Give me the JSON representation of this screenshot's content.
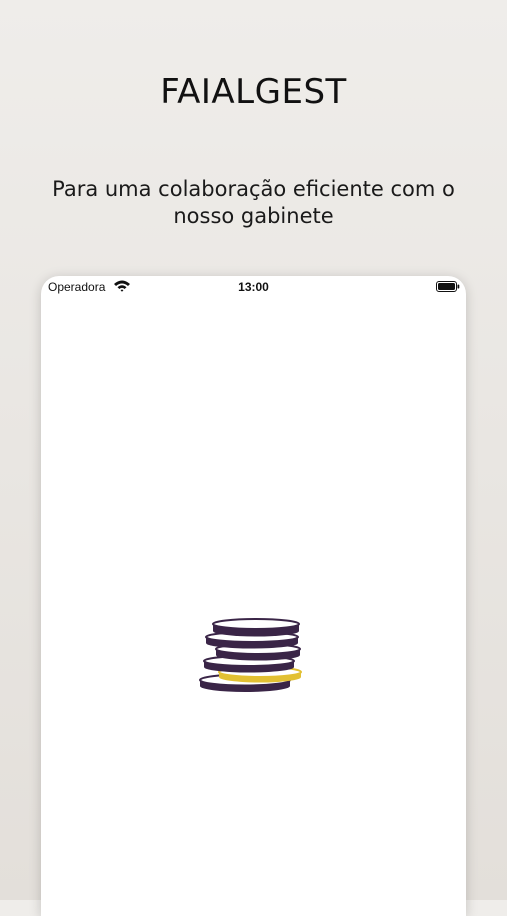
{
  "promo": {
    "title": "FAIALGEST",
    "subtitle": "Para uma colaboração eficiente com o nosso gabinete"
  },
  "status_bar": {
    "carrier": "Operadora",
    "time": "13:00",
    "icons": [
      "wifi-icon",
      "battery-icon"
    ]
  },
  "splash": {
    "logo_icon": "coin-stack-icon"
  },
  "colors": {
    "background": "#ebe8e4",
    "coin_dark": "#3a2547",
    "coin_gold": "#e2c033",
    "screen": "#ffffff"
  }
}
